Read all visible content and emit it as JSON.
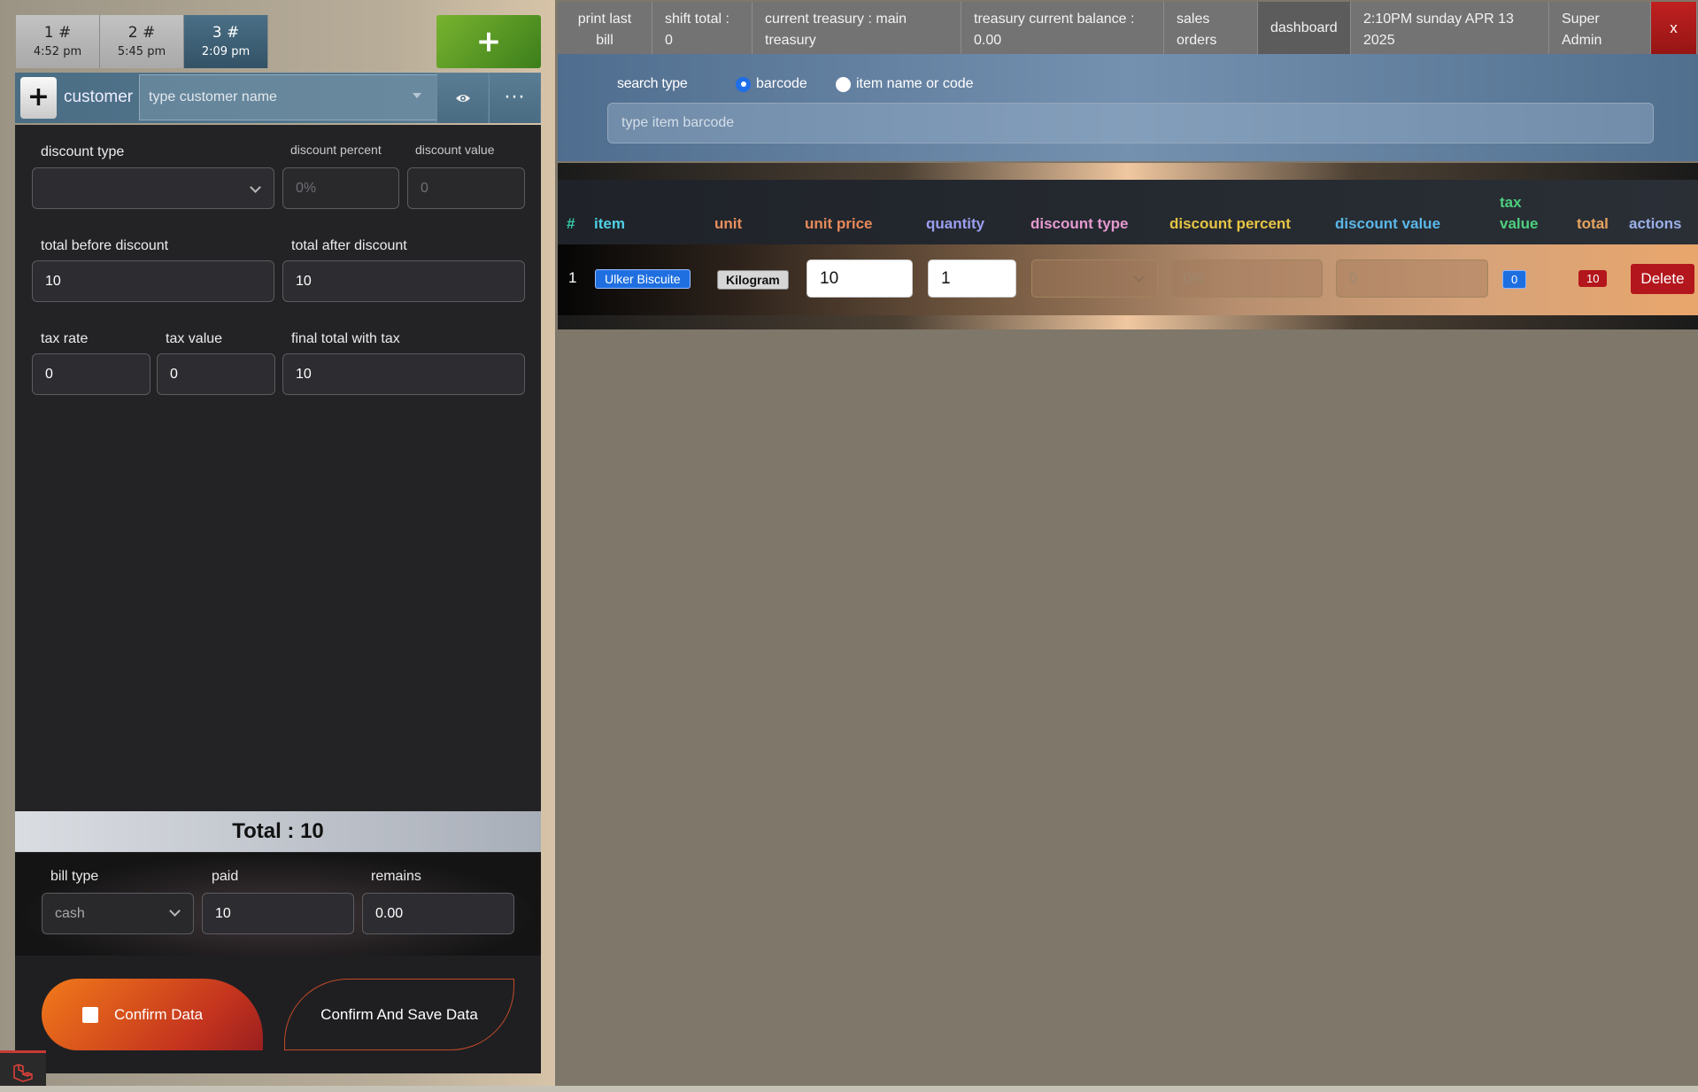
{
  "bill_tabs": [
    {
      "num": "1 #",
      "time": "4:52 pm"
    },
    {
      "num": "2 #",
      "time": "5:45 pm"
    },
    {
      "num": "3 #",
      "time": "2:09 pm"
    }
  ],
  "add_bill_label": "+",
  "customer": {
    "add_label": "+",
    "label": "customer",
    "placeholder": "type customer name",
    "more_label": "···"
  },
  "discount": {
    "type_label": "discount type",
    "type_value": "",
    "percent_label": "discount percent",
    "percent_placeholder": "0%",
    "value_label": "discount value",
    "value_placeholder": "0"
  },
  "totals": {
    "before_label": "total before discount",
    "before_value": "10",
    "after_label": "total after discount",
    "after_value": "10",
    "tax_rate_label": "tax rate",
    "tax_rate_value": "0",
    "tax_value_label": "tax value",
    "tax_value_value": "0",
    "final_label": "final total with tax",
    "final_value": "10"
  },
  "total_bar": "Total : 10",
  "payment": {
    "bill_type_label": "bill type",
    "bill_type_value": "cash",
    "paid_label": "paid",
    "paid_value": "10",
    "remains_label": "remains",
    "remains_value": "0.00"
  },
  "actions": {
    "confirm_label": "Confirm Data",
    "confirm_save_label": "Confirm And Save Data"
  },
  "top_nav": {
    "print_last_bill": "print last bill",
    "shift_total": "shift total : 0",
    "current_treasury": "current treasury : main treasury",
    "treasury_balance": "treasury current balance : 0.00",
    "sales_orders": "sales orders",
    "dashboard": "dashboard",
    "datetime": "2:10PM sunday APR 13 2025",
    "user": "Super Admin",
    "close": "x"
  },
  "search": {
    "type_label": "search type",
    "option_barcode": "barcode",
    "option_item": "item name or code",
    "placeholder": "type item barcode"
  },
  "table": {
    "headers": {
      "index": "#",
      "item": "item",
      "unit": "unit",
      "unit_price": "unit price",
      "quantity": "quantity",
      "discount_type": "discount type",
      "discount_percent": "discount percent",
      "discount_value": "discount value",
      "tax_value": "tax value",
      "total": "total",
      "actions": "actions"
    },
    "header_colors": {
      "index": "#35c9a7",
      "item": "#4fd0e6",
      "unit": "#e98f5f",
      "unit_price": "#e7895a",
      "quantity": "#9a9ff0",
      "discount_type": "#e59ad0",
      "discount_percent": "#e7c645",
      "discount_value": "#5bb7e8",
      "tax_value": "#4ccf7d",
      "total": "#e7a55f",
      "actions": "#9ab0e8"
    },
    "rows": [
      {
        "index": "1",
        "item": "Ulker Biscuite",
        "unit": "Kilogram",
        "unit_price": "10",
        "quantity": "1",
        "discount_type": "",
        "discount_percent": "0%",
        "discount_value": "0",
        "tax_value": "0",
        "total": "10",
        "delete_label": "Delete"
      }
    ]
  }
}
